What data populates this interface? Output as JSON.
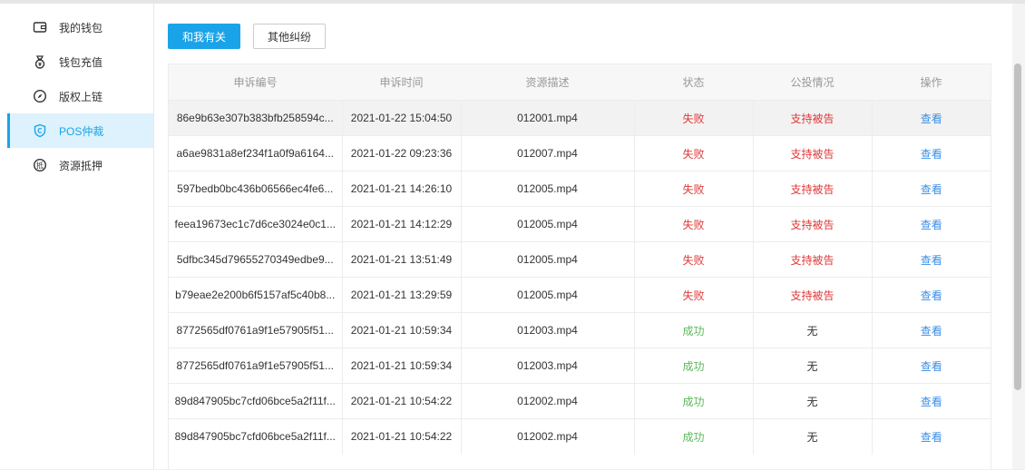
{
  "sidebar": {
    "items": [
      {
        "label": "我的钱包",
        "icon": "wallet-icon"
      },
      {
        "label": "钱包充值",
        "icon": "money-bag-icon"
      },
      {
        "label": "版权上链",
        "icon": "compass-icon"
      },
      {
        "label": "POS仲裁",
        "icon": "shield-icon",
        "active": true
      },
      {
        "label": "资源抵押",
        "icon": "pledge-icon"
      }
    ]
  },
  "tabs": {
    "mine": "和我有关",
    "others": "其他纠纷"
  },
  "table": {
    "headers": [
      "申诉编号",
      "申诉时间",
      "资源描述",
      "状态",
      "公投情况",
      "操作"
    ],
    "rows": [
      {
        "id": "86e9b63e307b383bfb258594c...",
        "time": "2021-01-22 15:04:50",
        "res": "012001.mp4",
        "status": "失败",
        "vote": "支持被告",
        "action": "查看"
      },
      {
        "id": "a6ae9831a8ef234f1a0f9a6164...",
        "time": "2021-01-22 09:23:36",
        "res": "012007.mp4",
        "status": "失败",
        "vote": "支持被告",
        "action": "查看"
      },
      {
        "id": "597bedb0bc436b06566ec4fe6...",
        "time": "2021-01-21 14:26:10",
        "res": "012005.mp4",
        "status": "失败",
        "vote": "支持被告",
        "action": "查看"
      },
      {
        "id": "feea19673ec1c7d6ce3024e0c1...",
        "time": "2021-01-21 14:12:29",
        "res": "012005.mp4",
        "status": "失败",
        "vote": "支持被告",
        "action": "查看"
      },
      {
        "id": "5dfbc345d79655270349edbe9...",
        "time": "2021-01-21 13:51:49",
        "res": "012005.mp4",
        "status": "失败",
        "vote": "支持被告",
        "action": "查看"
      },
      {
        "id": "b79eae2e200b6f5157af5c40b8...",
        "time": "2021-01-21 13:29:59",
        "res": "012005.mp4",
        "status": "失败",
        "vote": "支持被告",
        "action": "查看"
      },
      {
        "id": "8772565df0761a9f1e57905f51...",
        "time": "2021-01-21 10:59:34",
        "res": "012003.mp4",
        "status": "成功",
        "vote": "无",
        "action": "查看"
      },
      {
        "id": "8772565df0761a9f1e57905f51...",
        "time": "2021-01-21 10:59:34",
        "res": "012003.mp4",
        "status": "成功",
        "vote": "无",
        "action": "查看"
      },
      {
        "id": "89d847905bc7cfd06bce5a2f11f...",
        "time": "2021-01-21 10:54:22",
        "res": "012002.mp4",
        "status": "成功",
        "vote": "无",
        "action": "查看"
      },
      {
        "id": "89d847905bc7cfd06bce5a2f11f...",
        "time": "2021-01-21 10:54:22",
        "res": "012002.mp4",
        "status": "成功",
        "vote": "无",
        "action": "查看"
      }
    ]
  },
  "colors": {
    "accent": "#1aa3e8",
    "fail": "#e03a3a",
    "success": "#5cb85c",
    "link": "#3a8ee6"
  }
}
